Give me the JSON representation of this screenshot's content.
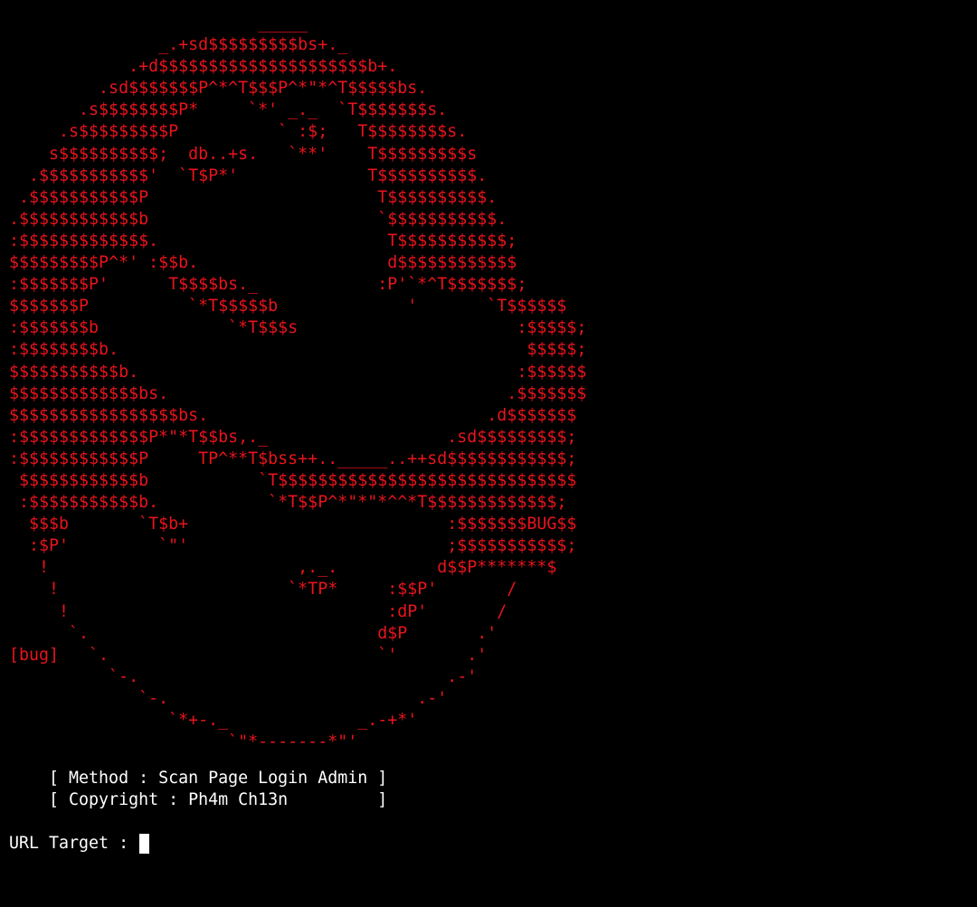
{
  "theme": {
    "background": "#000000",
    "art_color": "#e8141c",
    "text_color": "#ffffff",
    "cursor_color": "#ffffff"
  },
  "ascii_art": "                         _____\n               _.+sd$$$$$$$$$bs+._\n            .+d$$$$$$$$$$$$$$$$$$$$$b+.\n         .sd$$$$$$$P^*^T$$$P^*\"*^T$$$$$bs.\n       .s$$$$$$$$P*     `*' _._  `T$$$$$$$s.\n     .s$$$$$$$$$P          ` :$;   T$$$$$$$$s.\n    s$$$$$$$$$$;  db..+s.   `**'    T$$$$$$$$$s\n  .$$$$$$$$$$$'  `T$P*'             T$$$$$$$$$$.\n .$$$$$$$$$$$P                       T$$$$$$$$$$.\n.$$$$$$$$$$$$b                       `$$$$$$$$$$$.\n:$$$$$$$$$$$$$.                       T$$$$$$$$$$$;\n$$$$$$$$$P^*' :$$b.                   d$$$$$$$$$$$$\n:$$$$$$$P'      T$$$$bs._            :P'`*^T$$$$$$$;\n$$$$$$$P          `*T$$$$$b             '       `T$$$$$$\n:$$$$$$$b             `*T$$$s                      :$$$$$;\n:$$$$$$$$b.                                         $$$$$;\n$$$$$$$$$$$b.                                      :$$$$$$\n$$$$$$$$$$$$$bs.                                  .$$$$$$$\n$$$$$$$$$$$$$$$$$bs.                            .d$$$$$$$\n:$$$$$$$$$$$$$P*\"*T$$bs,._                  .sd$$$$$$$$$;\n:$$$$$$$$$$$$P     TP^**T$bss++.._____..++sd$$$$$$$$$$$$;\n $$$$$$$$$$$$b           `T$$$$$$$$$$$$$$$$$$$$$$$$$$$$$$\n :$$$$$$$$$$$b.           `*T$$P^*\"*\"*^^*T$$$$$$$$$$$$$;\n  $$$b       `T$b+                          :$$$$$$$BUG$$\n  :$P'         `\"'                          ;$$$$$$$$$$$;\n   !                         ,._.          d$$P*******$\n    !                       `*TP*     :$$P'       /\n     !                                :dP'       /\n      `.                             d$P       .'\n[bug]   `.                           `'       .'\n          `-.                               .-'\n             `-.                         .-'\n                `*+-._             _.-+*'\n                      `\"*-------*\"'",
  "info_lines": [
    "    [ Method : Scan Page Login Admin ]",
    "    [ Copyright : Ph4m Ch13n         ]"
  ],
  "prompt": {
    "label": "URL Target : ",
    "value": ""
  }
}
